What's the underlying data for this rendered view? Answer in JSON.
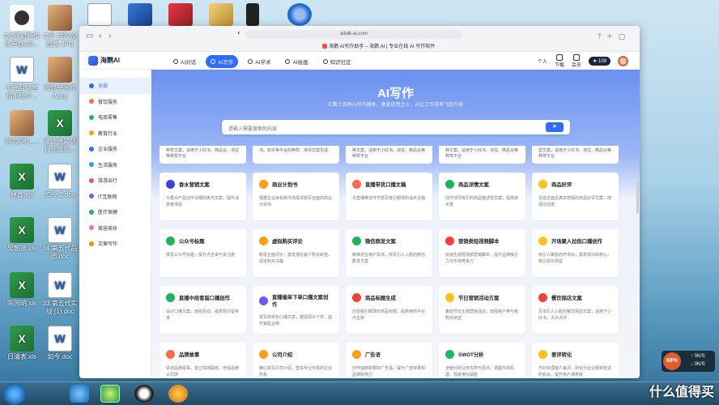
{
  "desktop": {
    "icons_left": [
      {
        "label": "QQ币最新惨\n改参数(38...",
        "type": "qq"
      },
      {
        "label": "Q币 换购设\n置表.JPG",
        "type": "img"
      },
      {
        "label": "卡元互动营\n销系统介...",
        "type": "doc"
      },
      {
        "label": "海登单图片\nA.jpg",
        "type": "img"
      },
      {
        "label": "2622081_...",
        "type": "img"
      },
      {
        "label": "速达通紧销\n行业情报...",
        "type": "xls"
      },
      {
        "label": "林鑫.xls",
        "type": "xls"
      },
      {
        "label": "如今 2.doc",
        "type": "doc"
      },
      {
        "label": "吴朝波.xls",
        "type": "xls"
      },
      {
        "label": "34.第五代品\n质.doc",
        "type": "doc"
      },
      {
        "label": "陈国明.xls",
        "type": "xls"
      },
      {
        "label": "33.第五代实\n战 (1).doc",
        "type": "doc"
      },
      {
        "label": "日清表.xls",
        "type": "xls"
      },
      {
        "label": "如今.doc",
        "type": "doc"
      }
    ],
    "watermark": "什么值得买"
  },
  "browser": {
    "url": "aitalk-ai.com",
    "tab_title": "海鹦 AI写作助手 – 海鹦 AI | 专业在线 AI 写作软件"
  },
  "app": {
    "logo": "海鹦AI",
    "nav": [
      {
        "label": "AI对话",
        "active": false
      },
      {
        "label": "AI写作",
        "active": true
      },
      {
        "label": "AI学术",
        "active": false
      },
      {
        "label": "AI绘画",
        "active": false
      },
      {
        "label": "知识社区",
        "active": false
      }
    ],
    "right": {
      "user": "个人",
      "download": "下载",
      "vip": "会员",
      "badge": "★ 109"
    }
  },
  "sidebar": [
    {
      "label": "全部",
      "color": "#2f6bff",
      "active": true
    },
    {
      "label": "餐饮服务",
      "color": "#ff6b4a"
    },
    {
      "label": "电商零售",
      "color": "#21b36a"
    },
    {
      "label": "教育行业",
      "color": "#ff9f1a"
    },
    {
      "label": "企业服务",
      "color": "#2f6bff"
    },
    {
      "label": "生活服务",
      "color": "#18b0c9"
    },
    {
      "label": "旅游出行",
      "color": "#f0506e"
    },
    {
      "label": "IT互联网",
      "color": "#6a5cff"
    },
    {
      "label": "医疗保健",
      "color": "#1fb35a"
    },
    {
      "label": "美容美妆",
      "color": "#ff6ab2"
    },
    {
      "label": "文章写作",
      "color": "#ff8a00"
    }
  ],
  "hero": {
    "title": "AI写作",
    "subtitle": "汇聚上百种AI写作模本，激发创意之火，AI让工作效率飞跃升级"
  },
  "search": {
    "placeholder": "请输入需要搜索的内容",
    "button": "➤"
  },
  "partial_cards": [
    "种草文案，适用于小红书、微品台、淘宝等种草平台",
    "书、知乎等平台的种草、测评文案生成",
    "等文案，适用于小红书、淘宝、微品台等种草平台",
    "种文案，适用于小红书、淘宝、微品台等种草平台",
    "型文案，适用于小红书、淘宝、微品台等种草平台"
  ],
  "cards": [
    {
      "title": "香水营销文案",
      "desc": "为香水产品创作详细的卖点文案，提升消费者体验",
      "color": "#3b46d9"
    },
    {
      "title": "商业计划书",
      "desc": "根据企业目标和市场需求撰写全面的商业计划书",
      "color": "#ff9f1a"
    },
    {
      "title": "直播带货口播文稿",
      "desc": "为直播带货环节撰写吸引眼球的话术文稿",
      "color": "#ff6b4a"
    },
    {
      "title": "商品详情文案",
      "desc": "创作详尽吸引的商品描述性文案，提高转化率",
      "color": "#1fb35a"
    },
    {
      "title": "商品好评",
      "desc": "生成正面且真实感强的商品好评文案，增强信任度",
      "color": "#ffc21a"
    },
    {
      "title": "公众号标题",
      "desc": "撰写公众号标题，提升点击率与关注度",
      "color": "#1fb35a"
    },
    {
      "title": "虚拟购买评论",
      "desc": "制造正面评价，激发潜在客户购买欲望，促进购买决策",
      "color": "#ff9f1a"
    },
    {
      "title": "微信群发文案",
      "desc": "精准定位用户需求，撰写引人入胜的微信群发文案",
      "color": "#1fb35a"
    },
    {
      "title": "营销类短视频脚本",
      "desc": "快速生成短视频营销脚本，提升品牌吸引力与市场竞争力",
      "color": "#f0443a"
    },
    {
      "title": "开场聚人拉段口播创作",
      "desc": "吸引人聚拢的开场白，激发观众好奇心，吸引观众停留",
      "color": "#ffc21a"
    },
    {
      "title": "直播中段客留口播创作",
      "desc": "设计口播文案，增强互动，提高观众留存率",
      "color": "#1fb35a"
    },
    {
      "title": "直播催单下单口播文案创作",
      "desc": "撰写高转化口播文案，催促观众下单，提升销售业绩",
      "color": "#6a5cff"
    },
    {
      "title": "商品标题生成",
      "desc": "创造吸引眼球的商品标题，提高电商平台点击率",
      "color": "#f0443a"
    },
    {
      "title": "节日营销活动方案",
      "desc": "策划节日主题营销活动，增强用户参与和购买欲望",
      "color": "#ffc21a"
    },
    {
      "title": "餐饮探店文案",
      "desc": "写出引人入胜的餐饮探店文案，适用于小红书、大众点评",
      "color": "#f0443a"
    },
    {
      "title": "品牌故事",
      "desc": "讲述品牌故事，建立情感联结，增强品牌认同感",
      "color": "#ff6b4a"
    },
    {
      "title": "公司介绍",
      "desc": "精心撰写公司介绍，塑造专业可靠的企业形象",
      "color": "#ff9f1a"
    },
    {
      "title": "广告语",
      "desc": "创作独特新颖的广告语，提升广告效果和品牌影响力",
      "color": "#ff9f1a"
    },
    {
      "title": "SWOT分析",
      "desc": "全面分析业务优势与弱点，把握市场机遇，规避潜在威胁",
      "color": "#21b36a"
    },
    {
      "title": "差评转化",
      "desc": "巧妙处理客户差评，转化为企业服务改进的机会，提升用户满意度",
      "color": "#ffc21a"
    }
  ],
  "net_widget": {
    "percent": "68%",
    "up": "0K/S",
    "down": "0K/S"
  }
}
